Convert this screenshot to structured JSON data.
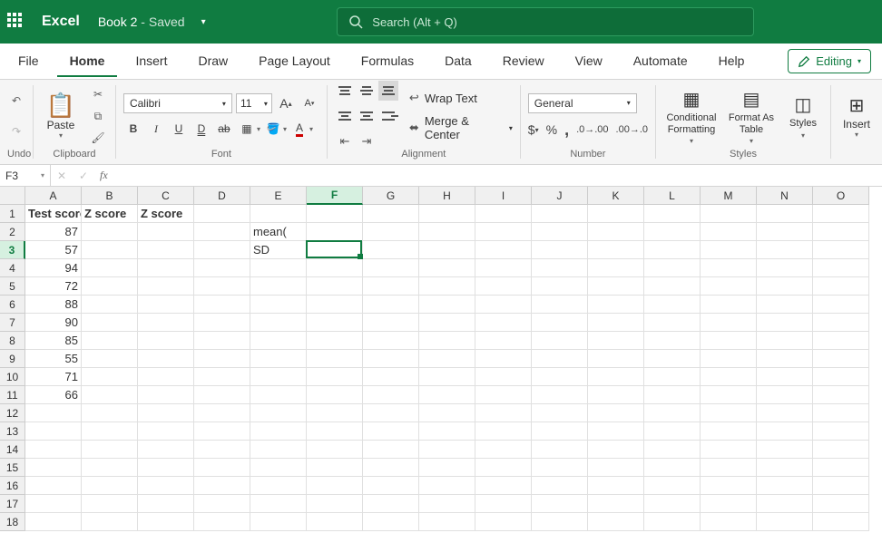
{
  "app": {
    "name": "Excel",
    "doc": "Book 2",
    "status": "Saved"
  },
  "search": {
    "placeholder": "Search (Alt + Q)"
  },
  "tabs": [
    "File",
    "Home",
    "Insert",
    "Draw",
    "Page Layout",
    "Formulas",
    "Data",
    "Review",
    "View",
    "Automate",
    "Help"
  ],
  "activeTab": "Home",
  "editing_mode": "Editing",
  "ribbon": {
    "undo_label": "Undo",
    "paste_label": "Paste",
    "clipboard_label": "Clipboard",
    "font_name": "Calibri",
    "font_size": "11",
    "font_label": "Font",
    "wrap_text": "Wrap Text",
    "merge_center": "Merge & Center",
    "alignment_label": "Alignment",
    "number_format": "General",
    "number_label": "Number",
    "conditional_formatting": "Conditional Formatting",
    "format_as_table": "Format As Table",
    "styles": "Styles",
    "styles_label": "Styles",
    "insert": "Insert"
  },
  "formula_bar": {
    "name_box": "F3",
    "formula": ""
  },
  "grid": {
    "columns": [
      "A",
      "B",
      "C",
      "D",
      "E",
      "F",
      "G",
      "H",
      "I",
      "J",
      "K",
      "L",
      "M",
      "N",
      "O"
    ],
    "rows": 18,
    "active_cell": {
      "col": "F",
      "row": 3
    },
    "data": {
      "A1": "Test score",
      "B1": "Z score",
      "C1": "Z score",
      "A2": "87",
      "A3": "57",
      "A4": "94",
      "A5": "72",
      "A6": "88",
      "A7": "90",
      "A8": "85",
      "A9": "55",
      "A10": "71",
      "A11": "66",
      "E2": "mean(",
      "E3": "SD"
    },
    "bold_cells": [
      "A1",
      "B1",
      "C1"
    ],
    "right_align_cells": [
      "A2",
      "A3",
      "A4",
      "A5",
      "A6",
      "A7",
      "A8",
      "A9",
      "A10",
      "A11"
    ]
  }
}
